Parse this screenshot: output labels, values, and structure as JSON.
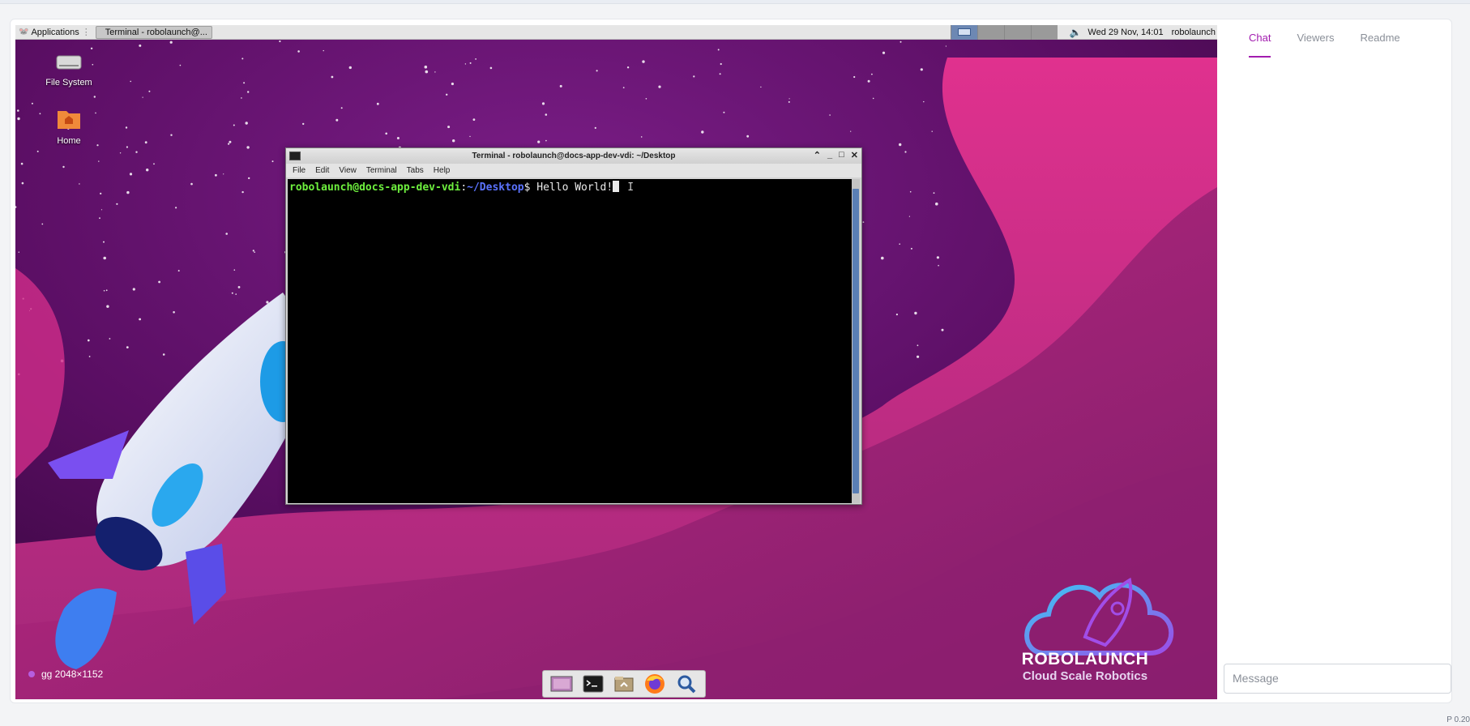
{
  "panel": {
    "applications_label": "Applications",
    "task_label": "Terminal - robolaunch@...",
    "clock": "Wed 29 Nov, 14:01",
    "user": "robolaunch",
    "workspaces": 4,
    "active_workspace": 1
  },
  "desktop_icons": [
    {
      "label": "File System",
      "icon": "drive-icon"
    },
    {
      "label": "Home",
      "icon": "home-folder-icon"
    }
  ],
  "terminal": {
    "title": "Terminal - robolaunch@docs-app-dev-vdi: ~/Desktop",
    "menu": [
      "File",
      "Edit",
      "View",
      "Terminal",
      "Tabs",
      "Help"
    ],
    "prompt_user": "robolaunch@docs-app-dev-vdi",
    "prompt_sep": ":",
    "prompt_path": "~/Desktop",
    "prompt_symbol": "$ ",
    "command": "Hello World!"
  },
  "resolution_label": "gg 2048×1152",
  "dock": [
    "workspace-switcher-icon",
    "terminal-icon",
    "file-manager-icon",
    "firefox-icon",
    "search-icon"
  ],
  "branding": {
    "name": "ROBOLAUNCH",
    "tagline": "Cloud Scale Robotics"
  },
  "sidebar": {
    "tabs": [
      {
        "label": "Chat",
        "active": true
      },
      {
        "label": "Viewers",
        "active": false
      },
      {
        "label": "Readme",
        "active": false
      }
    ],
    "message_placeholder": "Message"
  },
  "version": "P 0.20",
  "colors": {
    "accent": "#a21caf",
    "prompt_user": "#6ef03e",
    "prompt_path": "#5b73ff"
  }
}
